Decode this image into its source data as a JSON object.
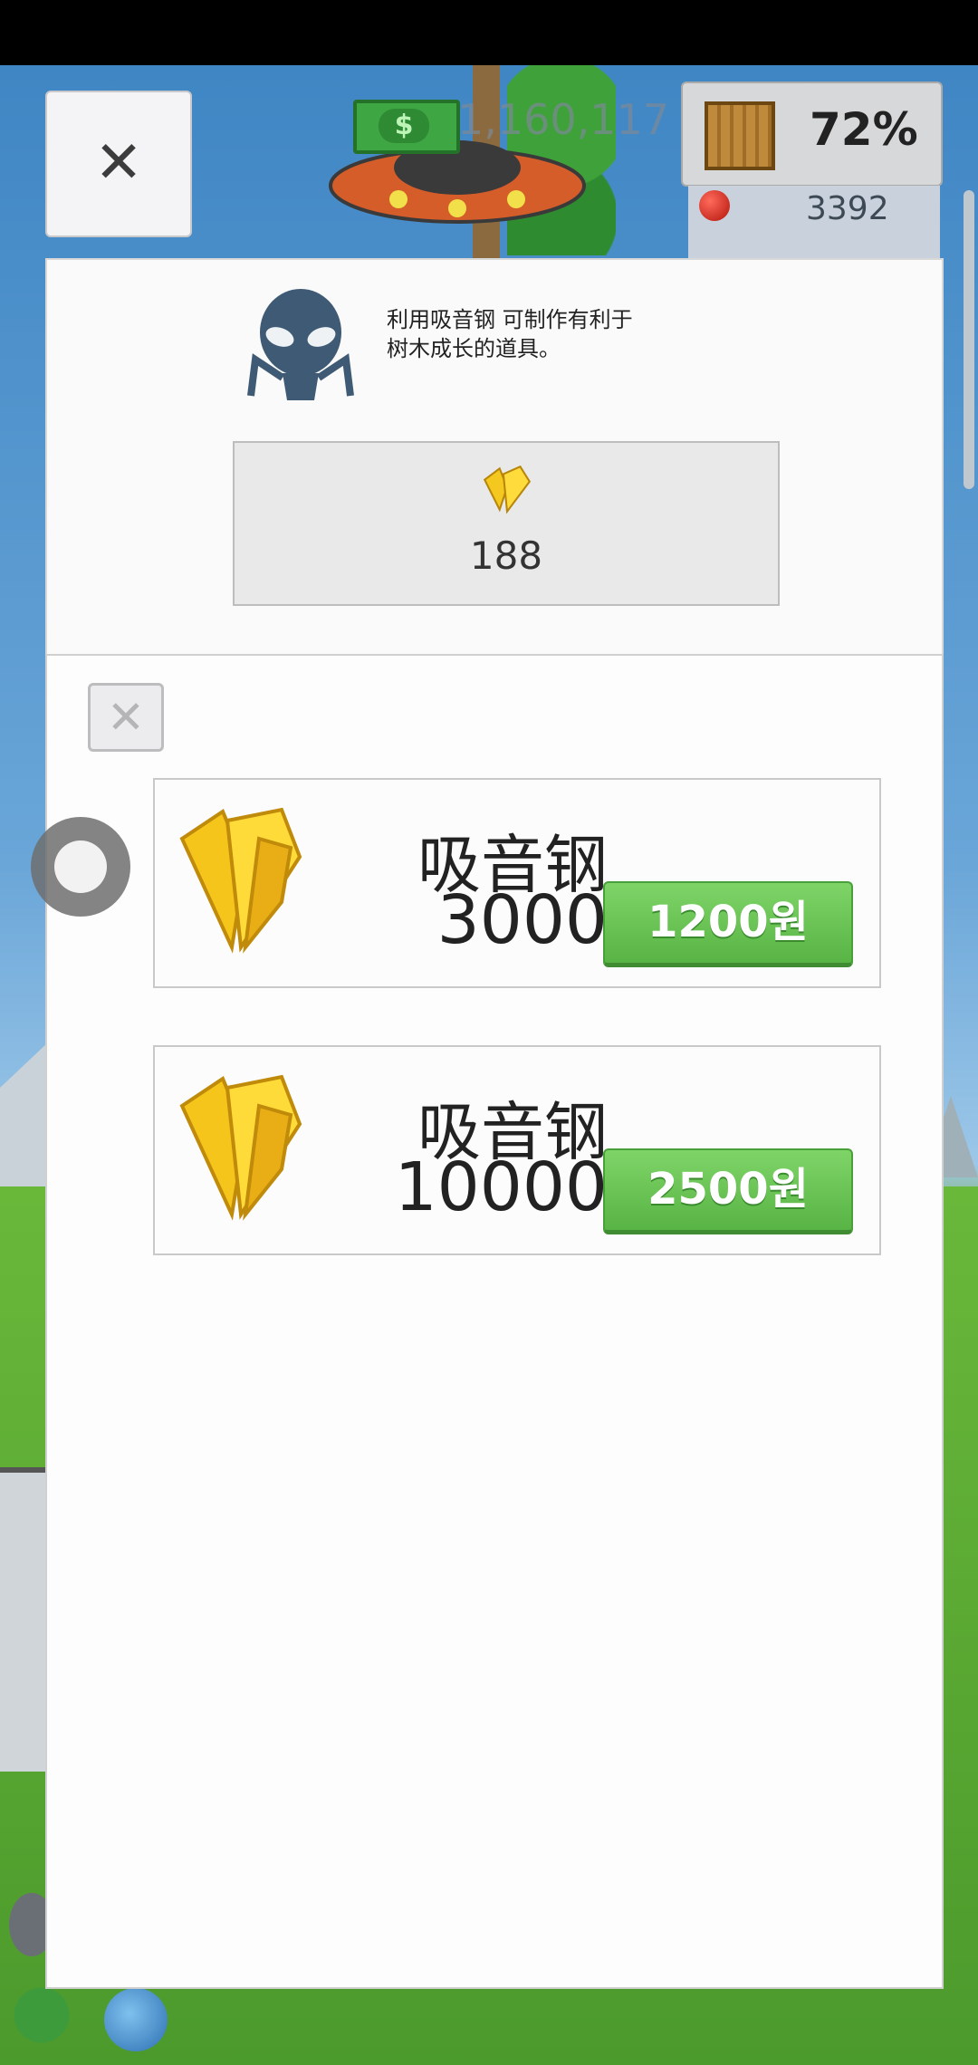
{
  "hud": {
    "money_symbol": "$",
    "money": "1,160,117",
    "crate_percent": "72%",
    "apple_count": "3392"
  },
  "outer_close": {
    "label": "✕"
  },
  "info": {
    "description": "利用吸音钢 可制作有利于\n树木成长的道具。",
    "current_amount": "188"
  },
  "store": {
    "close_label": "✕",
    "items": [
      {
        "name": "吸音钢",
        "quantity": "3000",
        "price": "1200원"
      },
      {
        "name": "吸音钢",
        "quantity": "10000",
        "price": "2500원"
      }
    ]
  },
  "colors": {
    "buy_button": "#5ab845",
    "gem": "#f2c31f"
  }
}
